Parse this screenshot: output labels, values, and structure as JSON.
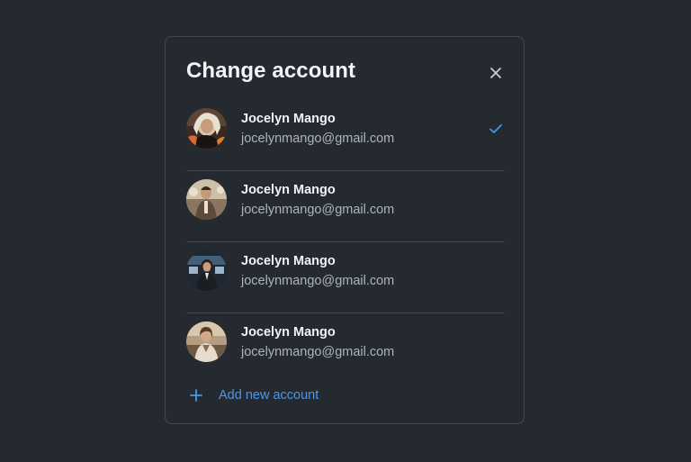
{
  "dialog": {
    "title": "Change account",
    "close_icon": "close-icon"
  },
  "accounts": [
    {
      "name": "Jocelyn Mango",
      "email": "jocelynmango@gmail.com",
      "selected": true,
      "avatar_icon": "avatar-photo"
    },
    {
      "name": "Jocelyn Mango",
      "email": "jocelynmango@gmail.com",
      "selected": false,
      "avatar_icon": "avatar-photo"
    },
    {
      "name": "Jocelyn Mango",
      "email": "jocelynmango@gmail.com",
      "selected": false,
      "avatar_icon": "avatar-photo"
    },
    {
      "name": "Jocelyn Mango",
      "email": "jocelynmango@gmail.com",
      "selected": false,
      "avatar_icon": "avatar-photo"
    }
  ],
  "add_account": {
    "label": "Add new account",
    "icon": "plus-icon"
  },
  "colors": {
    "background": "#252a31",
    "accent": "#4c97e6",
    "text_primary": "#f1f3f5",
    "text_secondary": "#aeb4bc",
    "divider": "#41464e"
  }
}
